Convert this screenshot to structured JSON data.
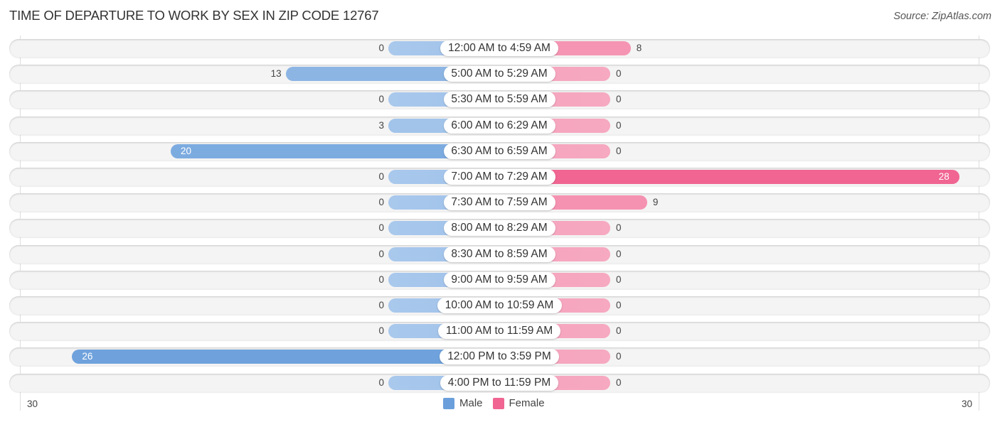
{
  "header": {
    "title": "TIME OF DEPARTURE TO WORK BY SEX IN ZIP CODE 12767",
    "source": "Source: ZipAtlas.com"
  },
  "colors": {
    "male_light": "#a9c8ec",
    "male_strong": "#6a9fdb",
    "female_light": "#f7a8c0",
    "female_strong": "#f06592"
  },
  "chart_data": {
    "type": "bar",
    "orientation": "horizontal-diverging",
    "title": "TIME OF DEPARTURE TO WORK BY SEX IN ZIP CODE 12767",
    "categories": [
      "12:00 AM to 4:59 AM",
      "5:00 AM to 5:29 AM",
      "5:30 AM to 5:59 AM",
      "6:00 AM to 6:29 AM",
      "6:30 AM to 6:59 AM",
      "7:00 AM to 7:29 AM",
      "7:30 AM to 7:59 AM",
      "8:00 AM to 8:29 AM",
      "8:30 AM to 8:59 AM",
      "9:00 AM to 9:59 AM",
      "10:00 AM to 10:59 AM",
      "11:00 AM to 11:59 AM",
      "12:00 PM to 3:59 PM",
      "4:00 PM to 11:59 PM"
    ],
    "series": [
      {
        "name": "Male",
        "values": [
          0,
          13,
          0,
          3,
          20,
          0,
          0,
          0,
          0,
          0,
          0,
          0,
          26,
          0
        ]
      },
      {
        "name": "Female",
        "values": [
          8,
          0,
          0,
          0,
          0,
          28,
          9,
          0,
          0,
          0,
          0,
          0,
          0,
          0
        ]
      }
    ],
    "axis": {
      "min_label": "30",
      "max_label": "30",
      "range": [
        -30,
        30
      ]
    },
    "legend": {
      "position": "bottom-center",
      "entries": [
        "Male",
        "Female"
      ]
    },
    "xlabel": "",
    "ylabel": ""
  }
}
